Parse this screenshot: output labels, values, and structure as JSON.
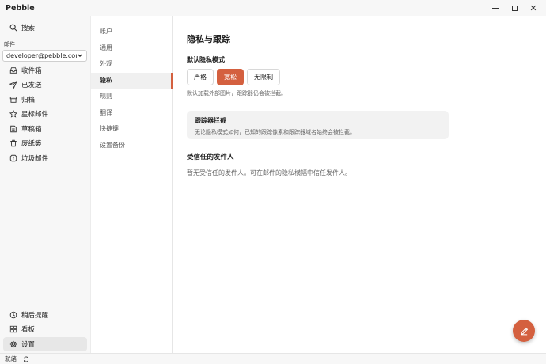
{
  "app": {
    "title": "Pebble"
  },
  "sidebar": {
    "search": "搜索",
    "mail_section": "邮件",
    "account": "developer@pebble.com",
    "folders": [
      {
        "label": "收件箱",
        "icon": "inbox-icon"
      },
      {
        "label": "已发送",
        "icon": "send-icon"
      },
      {
        "label": "归档",
        "icon": "archive-icon"
      },
      {
        "label": "星标邮件",
        "icon": "star-icon"
      },
      {
        "label": "草稿箱",
        "icon": "draft-icon"
      },
      {
        "label": "废纸篓",
        "icon": "trash-icon"
      },
      {
        "label": "垃圾邮件",
        "icon": "spam-icon"
      }
    ],
    "bottom": [
      {
        "label": "稍后提醒",
        "icon": "clock-icon"
      },
      {
        "label": "看板",
        "icon": "board-icon"
      },
      {
        "label": "设置",
        "icon": "gear-icon"
      }
    ]
  },
  "settings_nav": {
    "items": [
      "账户",
      "通用",
      "外观",
      "隐私",
      "规则",
      "翻译",
      "快捷键",
      "设置备份"
    ],
    "active": "隐私"
  },
  "privacy": {
    "title": "隐私与跟踪",
    "default_mode_label": "默认隐私模式",
    "modes": [
      "严格",
      "宽松",
      "无限制"
    ],
    "selected_mode": "宽松",
    "mode_hint": "默认加载外部图片，跟踪器仍会被拦截。",
    "tracker_card": {
      "title": "跟踪器拦截",
      "desc": "无论隐私模式如何，已知的跟踪像素和跟踪器域名始终会被拦截。"
    },
    "trusted_title": "受信任的发件人",
    "trusted_empty": "暂无受信任的发件人。可在邮件的隐私横幅中信任发件人。"
  },
  "status": {
    "text": "就绪"
  },
  "colors": {
    "accent": "#d4603f",
    "sidebar_bg": "#f7f7f7"
  }
}
